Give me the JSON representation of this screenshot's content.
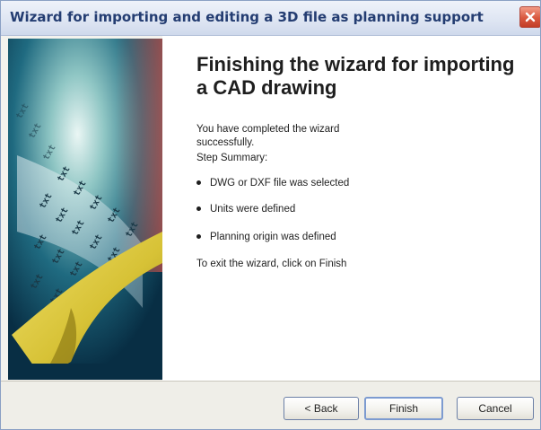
{
  "window": {
    "title": "Wizard for importing and editing a 3D file as planning support"
  },
  "content": {
    "heading": "Finishing the wizard for importing a CAD drawing",
    "completed_text_line1": "You have completed the wizard",
    "completed_text_line2": "successfully.",
    "summary_label": "Step Summary:",
    "summary_items": [
      "DWG or DXF file was selected",
      "Units were defined",
      "Planning origin was defined"
    ],
    "exit_text": "To exit the wizard, click on Finish"
  },
  "buttons": {
    "back": "< Back",
    "finish": "Finish",
    "cancel": "Cancel"
  },
  "art": {
    "file_label": "txt"
  },
  "colors": {
    "title_text": "#243d72",
    "close_button": "#d9583f",
    "art_background": "#0b3a52",
    "art_page": "#d7c236"
  }
}
